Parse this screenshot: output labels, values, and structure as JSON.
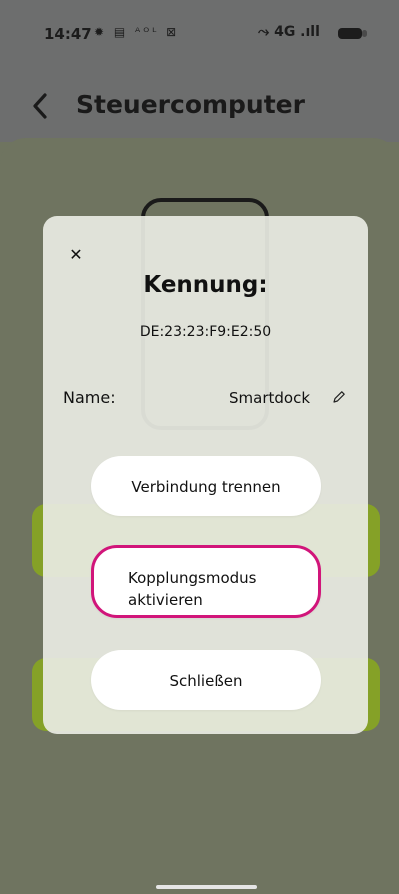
{
  "status_bar": {
    "time": "14:47",
    "left_icons": "✹ ▤ ᴬᴼᴸ ⊠",
    "network": "4G",
    "right_icons": "⤳ 4G .ıll"
  },
  "header": {
    "title": "Steuercomputer"
  },
  "modal": {
    "title": "Kennung:",
    "identifier": "DE:23:23:F9:E2:50",
    "name_label": "Name:",
    "name_value": "Smartdock",
    "buttons": {
      "disconnect": "Verbindung trennen",
      "pairing_mode": "Kopplungsmodus aktivieren",
      "close": "Schließen"
    }
  },
  "colors": {
    "accent_highlight": "#d1157a",
    "background": "#6f7460",
    "green_strip": "#85a127"
  }
}
